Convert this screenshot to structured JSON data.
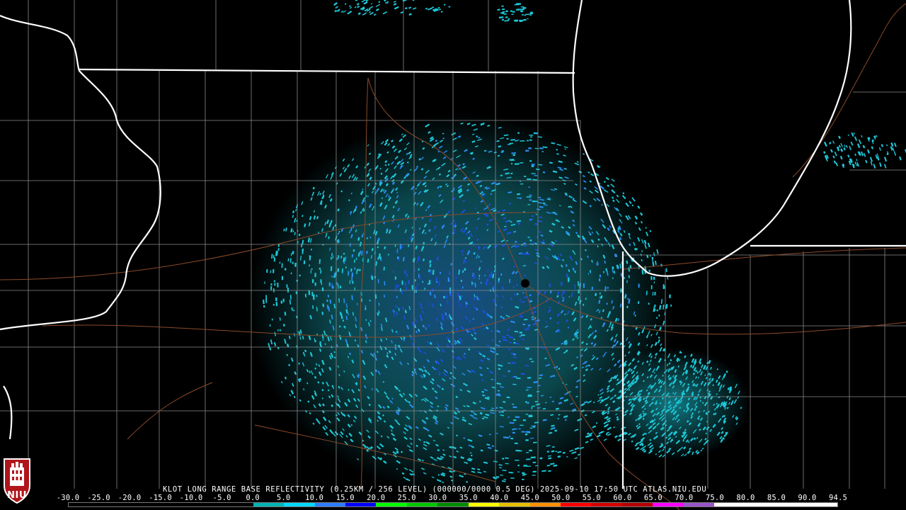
{
  "caption": "KLOT LONG RANGE BASE REFLECTIVITY (0.25KM / 256 LEVEL) (000000/0000 0.5 DEG) 2025-09-10 17:50 UTC  ATLAS.NIU.EDU",
  "logo_text": "NIU",
  "radar_site": "KLOT",
  "scale": {
    "labels": [
      "-30.0",
      "-25.0",
      "-20.0",
      "-15.0",
      "-10.0",
      "-5.0",
      "0.0",
      "5.0",
      "10.0",
      "15.0",
      "20.0",
      "25.0",
      "30.0",
      "35.0",
      "40.0",
      "45.0",
      "50.0",
      "55.0",
      "60.0",
      "65.0",
      "70.0",
      "75.0",
      "80.0",
      "85.0",
      "90.0",
      "94.5"
    ],
    "colors": [
      "#000000",
      "#000000",
      "#000000",
      "#000000",
      "#000000",
      "#000000",
      "#00b3b3",
      "#00d8ff",
      "#2f7dff",
      "#0000ff",
      "#00ff00",
      "#00c800",
      "#008c00",
      "#ffff00",
      "#e6c000",
      "#ff9000",
      "#ff0000",
      "#d40000",
      "#b40000",
      "#ff00ff",
      "#9955c9",
      "#ffffff",
      "#ffffff",
      "#ffffff",
      "#ffffff"
    ]
  },
  "colors": {
    "background": "#000000",
    "state_border": "#ffffff",
    "county_line": "#8a8a8a",
    "highway": "#8b4a2b",
    "echo_light": "#1ec8d8",
    "echo_mid": "#2a8cf0",
    "echo_strong": "#1c50e0"
  }
}
